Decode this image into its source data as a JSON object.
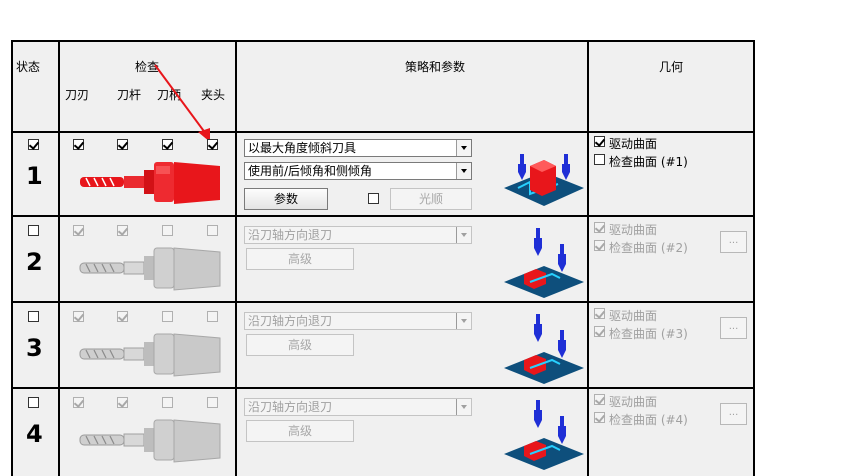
{
  "header": {
    "status": "状态",
    "check": "检查",
    "strategy": "策略和参数",
    "geometry": "几何",
    "sub": [
      "刀刃",
      "刀杆",
      "刀柄",
      "夹头"
    ]
  },
  "rows": [
    {
      "num": "1",
      "status_checked": true,
      "checks": [
        true,
        true,
        true,
        true
      ],
      "combo1": "以最大角度倾斜刀具",
      "combo2": "使用前/后倾角和侧倾角",
      "button": "参数",
      "smooth_label": "光顺",
      "smooth_checked": false,
      "drive": "驱动曲面",
      "check_surface": "检查曲面 (#1)",
      "drive_checked": true,
      "check_checked": false
    },
    {
      "num": "2",
      "status_checked": false,
      "checks": [
        true,
        true,
        false,
        false
      ],
      "combo1": "沿刀轴方向退刀",
      "button": "高级",
      "drive": "驱动曲面",
      "check_surface": "检查曲面 (#2)",
      "drive_checked": true,
      "check_checked": true,
      "more": "..."
    },
    {
      "num": "3",
      "status_checked": false,
      "checks": [
        true,
        true,
        false,
        false
      ],
      "combo1": "沿刀轴方向退刀",
      "button": "高级",
      "drive": "驱动曲面",
      "check_surface": "检查曲面 (#3)",
      "drive_checked": true,
      "check_checked": true,
      "more": "..."
    },
    {
      "num": "4",
      "status_checked": false,
      "checks": [
        true,
        true,
        false,
        false
      ],
      "combo1": "沿刀轴方向退刀",
      "button": "高级",
      "drive": "驱动曲面",
      "check_surface": "检查曲面 (#4)",
      "drive_checked": true,
      "check_checked": true,
      "more": "..."
    }
  ],
  "colors": {
    "active_tool": "#e8161b",
    "inactive_tool": "#c9c9c9",
    "annotation_arrow": "#e8161b",
    "scene_base": "#0e4f7c",
    "scene_blue": "#1f2fd6"
  }
}
